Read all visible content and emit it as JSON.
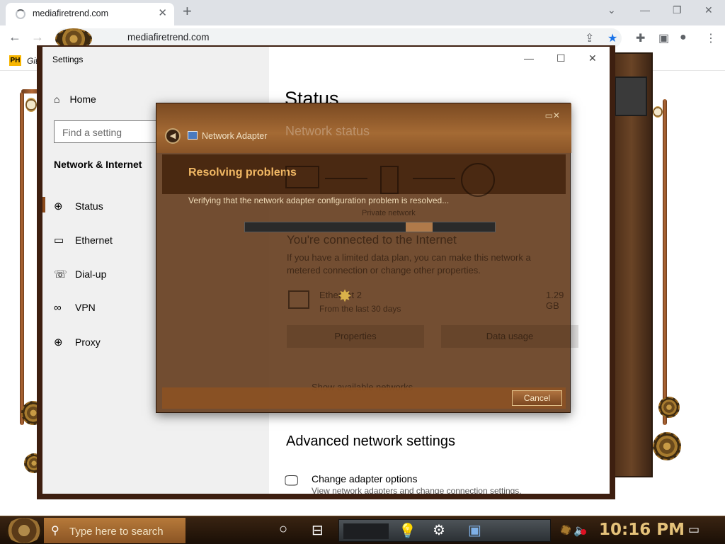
{
  "browser": {
    "tab_title": "mediafiretrend.com",
    "tab_close": "✕",
    "new_tab": "+",
    "url": "mediafiretrend.com",
    "bookmark_badge": "PH",
    "bookmark_label": "Git"
  },
  "settings": {
    "window_title": "Settings",
    "home_label": "Home",
    "search_placeholder": "Find a setting",
    "section_title": "Network & Internet",
    "nav": [
      {
        "label": "Status",
        "icon": "globe-icon"
      },
      {
        "label": "Ethernet",
        "icon": "ethernet-icon"
      },
      {
        "label": "Dial-up",
        "icon": "dialup-icon"
      },
      {
        "label": "VPN",
        "icon": "vpn-icon"
      },
      {
        "label": "Proxy",
        "icon": "globe-icon"
      }
    ],
    "main_title": "Status",
    "network_status": "Network status",
    "private_network": "Private network",
    "connected_title": "You're connected to the Internet",
    "connected_desc": "If you have a limited data plan, you can make this network a metered connection or change other properties.",
    "ethernet_name": "Ethernet 2",
    "ethernet_sub": "From the last 30 days",
    "ethernet_usage": "1.29 GB",
    "properties_btn": "Properties",
    "data_usage_btn": "Data usage",
    "show_networks": "Show available networks",
    "advanced_title": "Advanced network settings",
    "change_adapter": "Change adapter options",
    "change_adapter_sub": "View network adapters and change connection settings."
  },
  "troubleshooter": {
    "app_title": "Network Adapter",
    "heading": "Resolving problems",
    "status_text": "Verifying that the network adapter configuration problem is resolved...",
    "progress": 0.72,
    "cancel": "Cancel"
  },
  "taskbar": {
    "search_placeholder": "Type here to search",
    "clock": "10:16 PM"
  },
  "colors": {
    "accent": "#8a4a1c",
    "heading_orange": "#f1b864",
    "clock_gold": "#e5c27a"
  }
}
